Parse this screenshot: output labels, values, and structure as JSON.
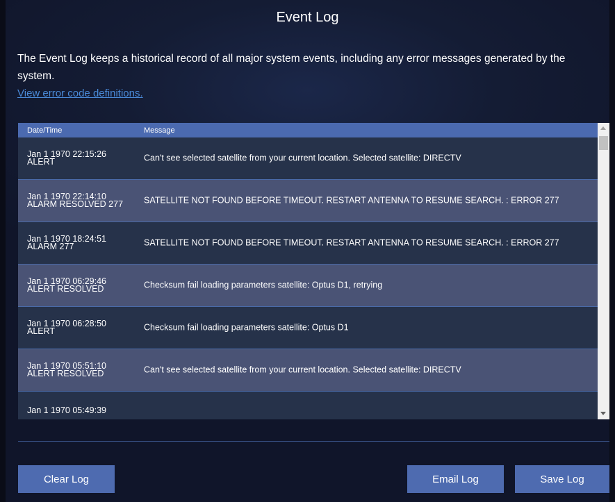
{
  "title": "Event Log",
  "description": "The Event Log keeps a historical record of all major system events, including any error messages generated by the system.",
  "link_text": "View error code definitions.",
  "table": {
    "headers": {
      "date": "Date/Time",
      "message": "Message"
    },
    "rows": [
      {
        "date": "Jan 1 1970 22:15:26",
        "type": "ALERT",
        "message": "Can't see selected satellite from your current location. Selected satellite: DIRECTV"
      },
      {
        "date": "Jan 1 1970 22:14:10",
        "type": "ALARM RESOLVED 277",
        "message": "SATELLITE NOT FOUND BEFORE TIMEOUT. RESTART ANTENNA TO RESUME SEARCH. : ERROR 277"
      },
      {
        "date": "Jan 1 1970 18:24:51",
        "type": "ALARM 277",
        "message": "SATELLITE NOT FOUND BEFORE TIMEOUT. RESTART ANTENNA TO RESUME SEARCH. : ERROR 277"
      },
      {
        "date": "Jan 1 1970 06:29:46",
        "type": "ALERT RESOLVED",
        "message": "Checksum fail loading parameters satellite: Optus D1, retrying"
      },
      {
        "date": "Jan 1 1970 06:28:50",
        "type": "ALERT",
        "message": "Checksum fail loading parameters satellite: Optus D1"
      },
      {
        "date": "Jan 1 1970 05:51:10",
        "type": "ALERT RESOLVED",
        "message": "Can't see selected satellite from your current location. Selected satellite: DIRECTV"
      },
      {
        "date": "Jan 1 1970 05:49:39",
        "type": "",
        "message": ""
      }
    ]
  },
  "buttons": {
    "clear": "Clear Log",
    "email": "Email Log",
    "save": "Save Log"
  },
  "colors": {
    "accent": "#4e6bb0",
    "row_dark": "#26324a",
    "row_light": "#4a5375",
    "link": "#4a8ad8"
  }
}
